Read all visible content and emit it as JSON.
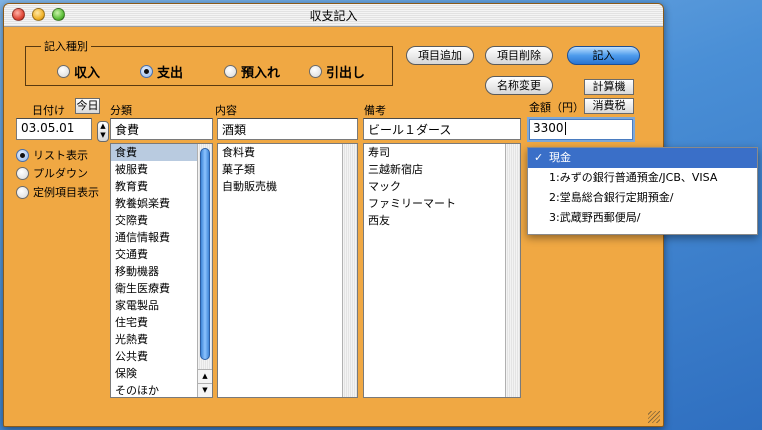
{
  "window": {
    "title": "収支記入"
  },
  "entry_type": {
    "label": "記入種別",
    "options": [
      {
        "label": "収入",
        "selected": false
      },
      {
        "label": "支出",
        "selected": true
      },
      {
        "label": "預入れ",
        "selected": false
      },
      {
        "label": "引出し",
        "selected": false
      }
    ]
  },
  "buttons": {
    "add_item": "項目追加",
    "delete_item": "項目削除",
    "submit": "記入",
    "rename": "名称変更",
    "calculator": "計算機",
    "tax": "消費税",
    "today": "今日"
  },
  "fields": {
    "date_label": "日付け",
    "date_value": "03.05.01",
    "category_label": "分類",
    "category_value": "食費",
    "content_label": "内容",
    "content_value": "酒類",
    "note_label": "備考",
    "note_value": "ビール１ダース",
    "amount_label": "金額（円）",
    "amount_value": "3300"
  },
  "view_mode": {
    "options": [
      {
        "label": "リスト表示",
        "selected": true
      },
      {
        "label": "プルダウン",
        "selected": false
      },
      {
        "label": "定例項目表示",
        "selected": false
      }
    ]
  },
  "lists": {
    "categories": [
      "食費",
      "被服費",
      "教育費",
      "教養娯楽費",
      "交際費",
      "通信情報費",
      "交通費",
      "移動機器",
      "衛生医療費",
      "家電製品",
      "住宅費",
      "光熱費",
      "公共費",
      "保険",
      "そのほか"
    ],
    "contents": [
      "食料費",
      "菓子類",
      "自動販売機"
    ],
    "notes": [
      "寿司",
      "三越新宿店",
      "マック",
      "ファミリーマート",
      "西友"
    ]
  },
  "account_popup": {
    "items": [
      "現金",
      "1:みずの銀行普通預金/JCB、VISA",
      "2:堂島総合銀行定期預金/",
      "3:武蔵野西郵便局/"
    ],
    "selected_index": 0
  },
  "colors": {
    "window_bg": "#f0a843",
    "accent": "#3a6fc8"
  }
}
